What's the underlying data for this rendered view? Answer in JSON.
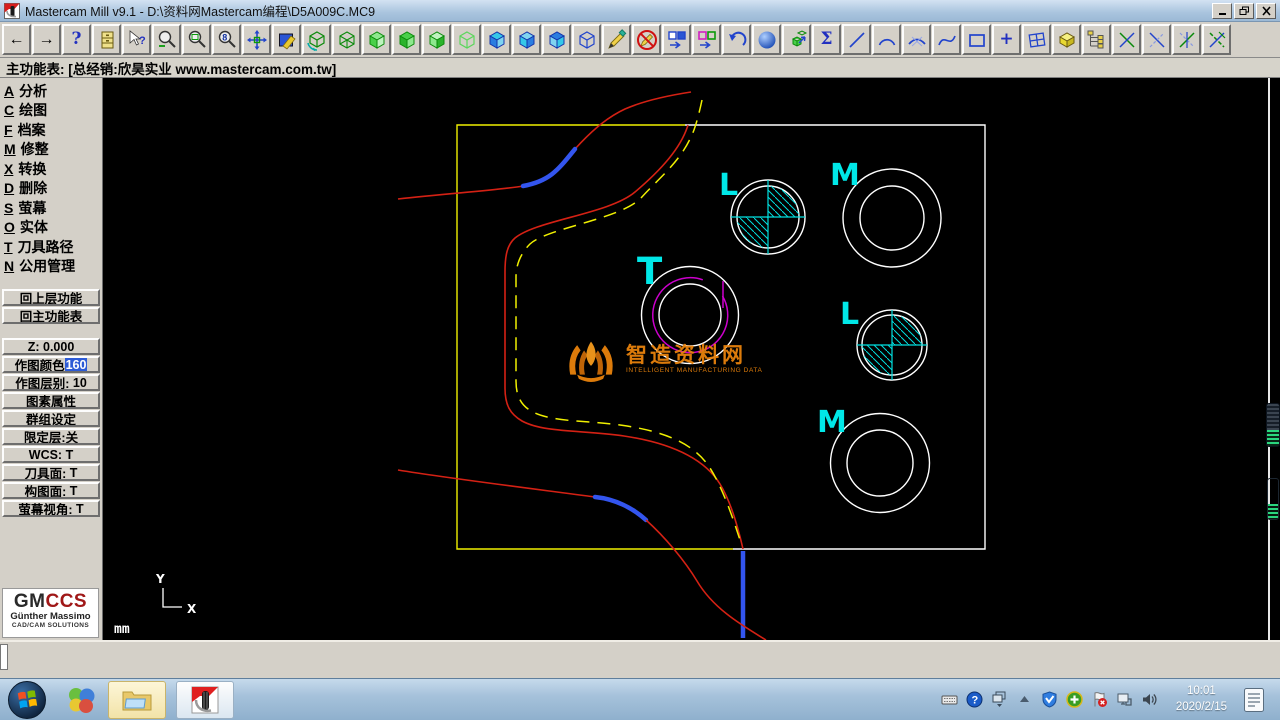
{
  "titlebar": {
    "title": "Mastercam Mill v9.1 - D:\\资料网Mastercam编程\\D5A009C.MC9",
    "controls": [
      "minimize",
      "restore",
      "close"
    ]
  },
  "toolbar": {
    "icons": [
      "back",
      "forward",
      "help",
      "file-cabinet",
      "cursor-help",
      "zoom",
      "zoom-window",
      "zoom-scale",
      "pan",
      "repaint",
      "dynamic-rotate",
      "gview-wireframe-cube",
      "gview-top-cube",
      "gview-front-cube",
      "gview-side-cube",
      "cplane-iso-cube",
      "cplane-top-cube",
      "cplane-front-cube",
      "cplane-side-cube",
      "delete-pencil",
      "undelete-pencil",
      "screen-blank",
      "screen-colors",
      "undo",
      "shade-sphere",
      "solid-copy",
      "sigma",
      "create-line",
      "create-arc",
      "trim-curve",
      "create-spline",
      "create-rectangle",
      "create-point",
      "viewports",
      "solid-box",
      "operations-tree",
      "trim-one",
      "trim-two",
      "trim-divide",
      "trim-three"
    ]
  },
  "menubar": {
    "text": "主功能表: [总经销:欣昊实业 www.mastercam.com.tw]"
  },
  "sidebar": {
    "menu_items": [
      {
        "hotkey": "A",
        "label": "分析"
      },
      {
        "hotkey": "C",
        "label": "绘图"
      },
      {
        "hotkey": "F",
        "label": "档案"
      },
      {
        "hotkey": "M",
        "label": "修整"
      },
      {
        "hotkey": "X",
        "label": "转换"
      },
      {
        "hotkey": "D",
        "label": "删除"
      },
      {
        "hotkey": "S",
        "label": "萤幕"
      },
      {
        "hotkey": "O",
        "label": "实体"
      },
      {
        "hotkey": "T",
        "label": "刀具路径"
      },
      {
        "hotkey": "N",
        "label": "公用管理"
      }
    ],
    "back_button": "回上层功能",
    "main_menu_button": "回主功能表",
    "z_label": "Z:",
    "z_value": "0.000",
    "color_label": "作图颜色",
    "color_value": "160",
    "level_label": "作图层别:",
    "level_value": "10",
    "attributes_button": "图素属性",
    "groups_button": "群组设定",
    "mask_label": "限定层:",
    "mask_value": "关",
    "wcs_label": "WCS:",
    "wcs_value": "T",
    "tplane_label": "刀具面:",
    "tplane_value": "T",
    "cplane_label": "构图面:",
    "cplane_value": "T",
    "gview_label": "萤幕视角:",
    "gview_value": "T",
    "logo": {
      "gm": "GM",
      "ccs": "CCS",
      "line2": "Günther Massimo",
      "line3": "CAD/CAM SOLUTIONS"
    }
  },
  "canvas": {
    "units_label": "mm",
    "axis_x": "X",
    "axis_y": "Y",
    "labels": {
      "t": "T",
      "l1": "L",
      "m1": "M",
      "l2": "L",
      "m2": "M"
    },
    "watermark": {
      "title": "智造资料网",
      "subtitle": "INTELLIGENT MANUFACTURING DATA"
    },
    "colors": {
      "boundary_yellow": "#f0f000",
      "stock_white": "#ffffff",
      "geometry_red": "#d42114",
      "toolpath_dashed_yellow": "#f0f000",
      "highlight_blue": "#3355ee",
      "hatch_cyan": "#00ffff",
      "helix_magenta": "#cc00cc"
    }
  },
  "taskbar": {
    "time": "10:01",
    "date": "2020/2/15"
  }
}
